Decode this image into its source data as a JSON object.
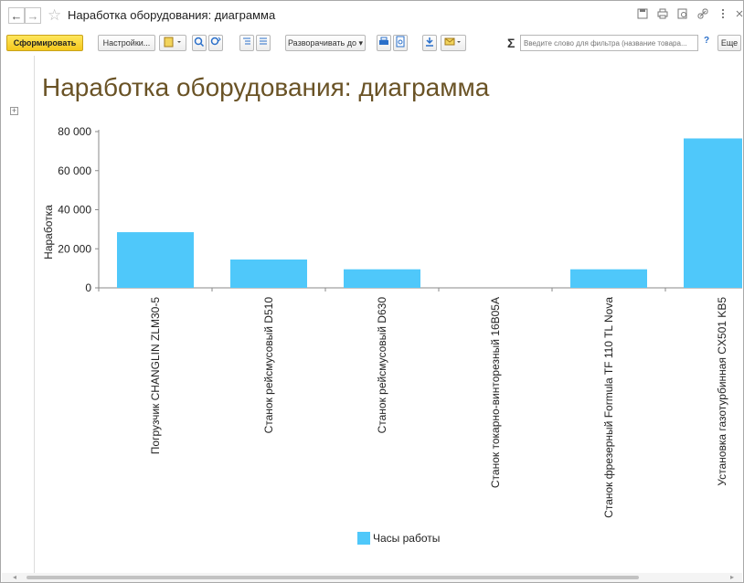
{
  "window": {
    "title": "Наработка оборудования: диаграмма",
    "back_glyph": "←",
    "forward_glyph": "→",
    "star_glyph": "☆",
    "icons": [
      "save-icon",
      "print-icon",
      "preview-icon",
      "link-icon",
      "more-icon",
      "close-icon"
    ]
  },
  "toolbar": {
    "generate_label": "Сформировать",
    "settings_label": "Настройки...",
    "expand_label": "Разворачивать до",
    "search_placeholder": "Введите слово для фильтра (название товара...",
    "help_label": "?",
    "more_label": "Еще",
    "sigma_glyph": "Σ"
  },
  "report": {
    "title": "Наработка оборудования: диаграмма",
    "expander_glyph": "+"
  },
  "chart_data": {
    "type": "bar",
    "title": "",
    "xlabel": "",
    "ylabel": "Наработка",
    "categories": [
      "Погрузчик CHANGLIN ZLM30-5",
      "Станок рейсмусовый D510",
      "Станок рейсмусовый D630",
      "Станок токарно-винторезный 16В05А",
      "Станок фрезерный Formula TF 110 TL Nova",
      "Установка газотурбинная CX501 KB5"
    ],
    "series": [
      {
        "name": "Часы работы",
        "values": [
          28500,
          14500,
          9500,
          0,
          9500,
          76500
        ],
        "color": "#4fc8fa"
      }
    ],
    "ylim": [
      0,
      80000
    ],
    "yticks": [
      "0",
      "20 000",
      "40 000",
      "60 000",
      "80 000"
    ],
    "ytick_values": [
      0,
      20000,
      40000,
      60000,
      80000
    ],
    "grid": false,
    "legend_position": "bottom"
  }
}
